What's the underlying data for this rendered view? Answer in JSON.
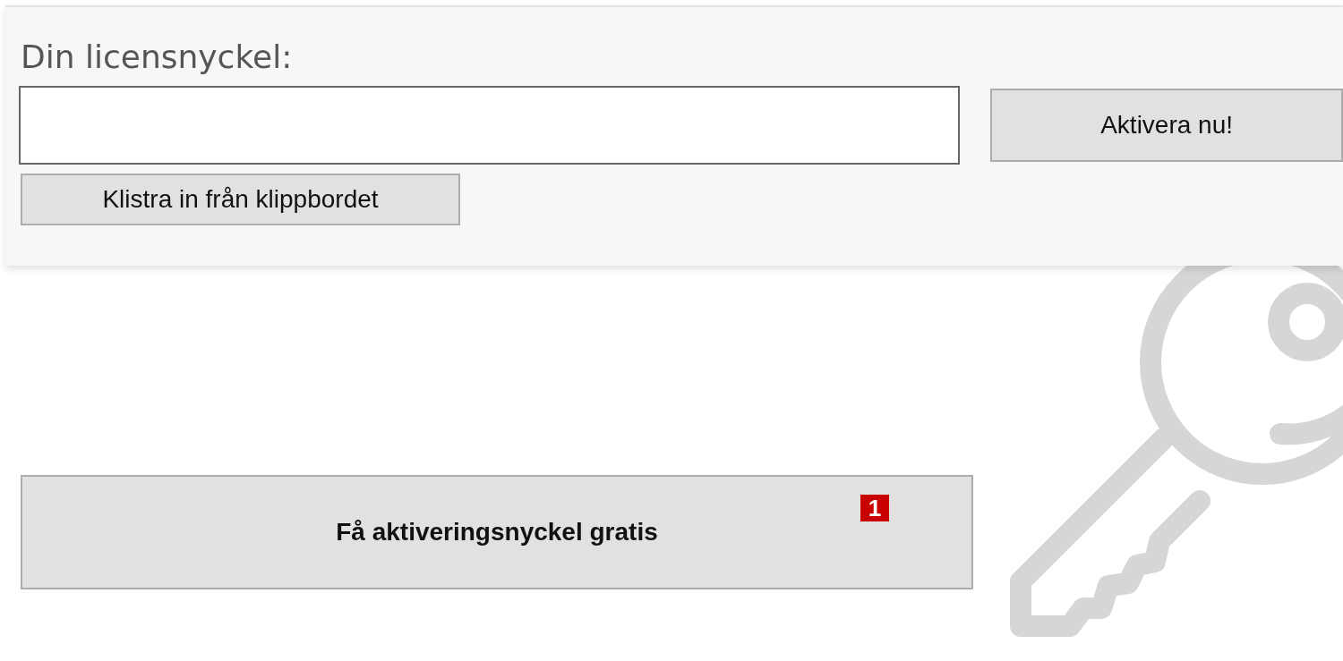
{
  "license_panel": {
    "title": "Din licensnyckel:",
    "activate_button": "Aktivera nu!",
    "paste_button": "Klistra in från klippbordet"
  },
  "free_key_button": {
    "label": "Få aktiveringsnyckel gratis",
    "badge": "1"
  }
}
